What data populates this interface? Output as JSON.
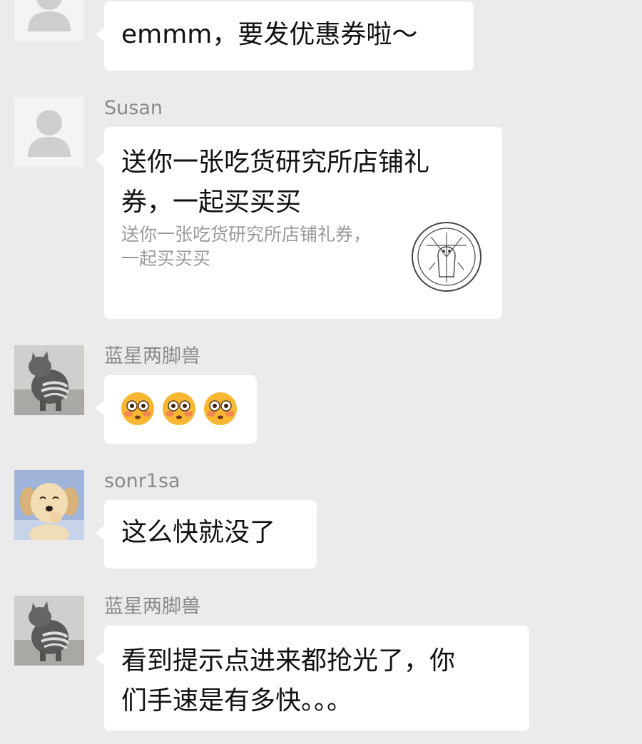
{
  "messages": [
    {
      "sender": "",
      "avatar": "default-avatar-icon",
      "text": "emmm，要发优惠券啦～"
    },
    {
      "sender": "Susan",
      "avatar": "default-avatar-icon",
      "card": {
        "title": "送你一张吃货研究所店铺礼券，一起买买买",
        "description": "送你一张吃货研究所店铺礼券，一起买买买",
        "icon": "shop-seal-logo"
      }
    },
    {
      "sender": "蓝星两脚兽",
      "avatar": "cat-avatar",
      "emojis": [
        "flushed-face-icon",
        "flushed-face-icon",
        "flushed-face-icon"
      ]
    },
    {
      "sender": "sonr1sa",
      "avatar": "puppy-avatar",
      "text": "这么快就没了"
    },
    {
      "sender": "蓝星两脚兽",
      "avatar": "cat-avatar",
      "text_lines": [
        "看到提示点进来都抢光了，你",
        "们手速是有多快。。。"
      ]
    }
  ],
  "colors": {
    "background": "#ebebeb",
    "bubble": "#ffffff",
    "sender_text": "#8a8a8a",
    "card_desc_text": "#9a9a9a"
  }
}
